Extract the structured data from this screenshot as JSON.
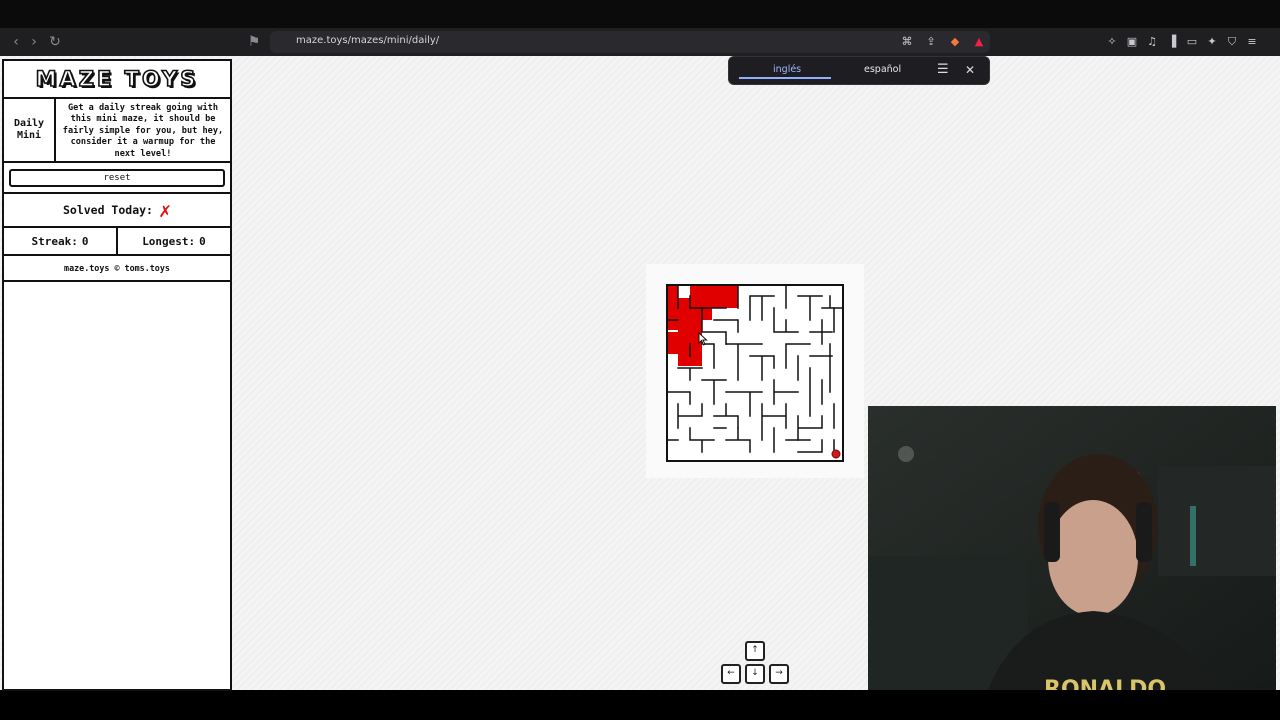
{
  "browser": {
    "url": "maze.toys/mazes/mini/daily/",
    "nav": {
      "back_icon": "‹",
      "forward_icon": "›",
      "reload_icon": "↻"
    }
  },
  "translate_popup": {
    "tab_source": "inglés",
    "tab_target": "español",
    "menu_icon": "☰",
    "close_icon": "✕"
  },
  "sidebar": {
    "logo": "MAZE TOYS",
    "mode_title": "Daily Mini",
    "description": "Get a daily streak going with this mini maze, it should be fairly simple for you, but hey, consider it a warmup for the next level!",
    "reset_label": "reset",
    "solved_label": "Solved Today:",
    "solved_mark": "✗",
    "streak_label": "Streak:",
    "streak_value": "0",
    "longest_label": "Longest:",
    "longest_value": "0",
    "credit": "maze.toys © toms.toys"
  },
  "controls": {
    "up": "↑",
    "left": "←",
    "down": "↓",
    "right": "→"
  },
  "colors": {
    "path": "#e00000",
    "goal": "#d11a1a",
    "wall": "#111111"
  },
  "webcam_shirt_text": "RONALDO"
}
